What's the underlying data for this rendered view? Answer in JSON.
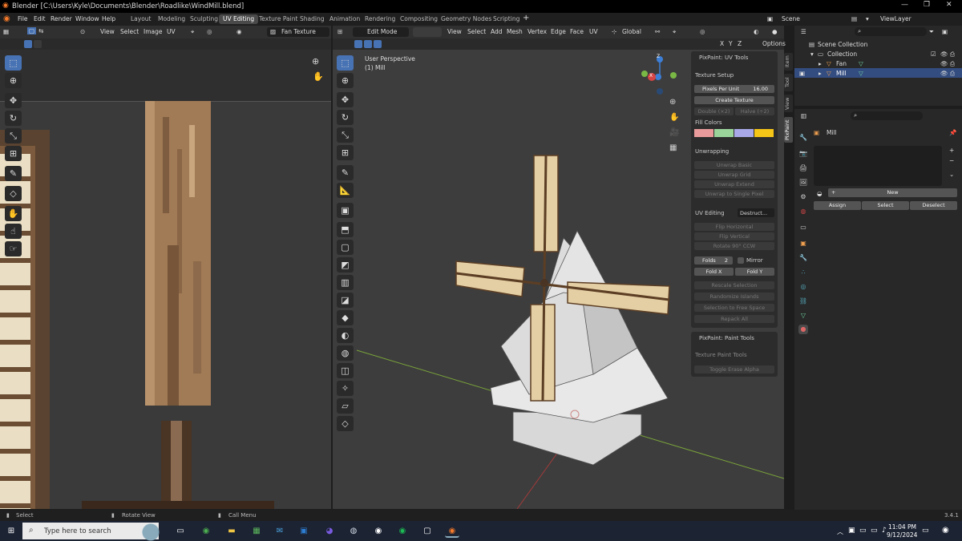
{
  "window": {
    "title": "Blender [C:\\Users\\Kyle\\Documents\\Blender\\Roadlike\\WindMill.blend]"
  },
  "menu": [
    "File",
    "Edit",
    "Render",
    "Window",
    "Help"
  ],
  "workspaces": [
    "Layout",
    "Modeling",
    "Sculpting",
    "UV Editing",
    "Texture Paint",
    "Shading",
    "Animation",
    "Rendering",
    "Compositing",
    "Geometry Nodes",
    "Scripting"
  ],
  "active_workspace": "UV Editing",
  "scene": "Scene",
  "viewlayer": "ViewLayer",
  "uv_editor": {
    "menus": [
      "View",
      "Select",
      "Image",
      "UV"
    ],
    "image_name": "Fan Texture"
  },
  "viewport": {
    "mode": "Edit Mode",
    "menus": [
      "View",
      "Select",
      "Add",
      "Mesh",
      "Vertex",
      "Edge",
      "Face",
      "UV"
    ],
    "orientation": "Global",
    "perspective_label": "User Perspective",
    "object_label": "(1) Mill",
    "options": "Options",
    "axis_x": "X",
    "axis_y": "Y",
    "axis_z": "Z",
    "gizmo_x": "X",
    "gizmo_z": "Z"
  },
  "side_tabs": [
    "Item",
    "Tool",
    "View",
    "PixPaint"
  ],
  "npanel": {
    "uv_tools_title": "PixPaint: UV Tools",
    "texture_setup": "Texture Setup",
    "pixels_per_unit_label": "Pixels Per Unit",
    "pixels_per_unit_value": "16.00",
    "create_texture": "Create Texture",
    "double": "Double (×2)",
    "halve": "Halve (÷2)",
    "fill_colors": "Fill Colors",
    "fill_swatches": [
      "#e99a9a",
      "#9ad49b",
      "#a8a8e8",
      "#f5c518"
    ],
    "unwrapping": "Unwrapping",
    "unwrap_basic": "Unwrap Basic",
    "unwrap_grid": "Unwrap Grid",
    "unwrap_extend": "Unwrap Extend",
    "unwrap_single": "Unwrap to Single Pixel",
    "uv_editing": "UV Editing",
    "destructive": "Destruct...",
    "flip_h": "Flip Horizontal",
    "flip_v": "Flip Vertical",
    "rotate": "Rotate 90° CCW",
    "folds_label": "Folds",
    "folds_value": "2",
    "mirror": "Mirror",
    "fold_x": "Fold X",
    "fold_y": "Fold Y",
    "rescale": "Rescale Selection",
    "randomize": "Randomize Islands",
    "selection_free": "Selection to Free Space",
    "repack": "Repack All",
    "paint_tools_title": "PixPaint: Paint Tools",
    "texture_paint_tools": "Texture Paint Tools",
    "toggle_erase": "Toggle Erase Alpha"
  },
  "outliner": {
    "root": "Scene Collection",
    "collection": "Collection",
    "items": [
      {
        "name": "Fan"
      },
      {
        "name": "Mill"
      }
    ]
  },
  "properties": {
    "object": "Mill",
    "new": "New",
    "assign": "Assign",
    "select": "Select",
    "deselect": "Deselect"
  },
  "statusbar": {
    "select": "Select",
    "rotate_view": "Rotate View",
    "call_menu": "Call Menu",
    "version": "3.4.1"
  },
  "taskbar": {
    "search_placeholder": "Type here to search",
    "time": "11:04 PM",
    "date": "9/12/2024"
  }
}
